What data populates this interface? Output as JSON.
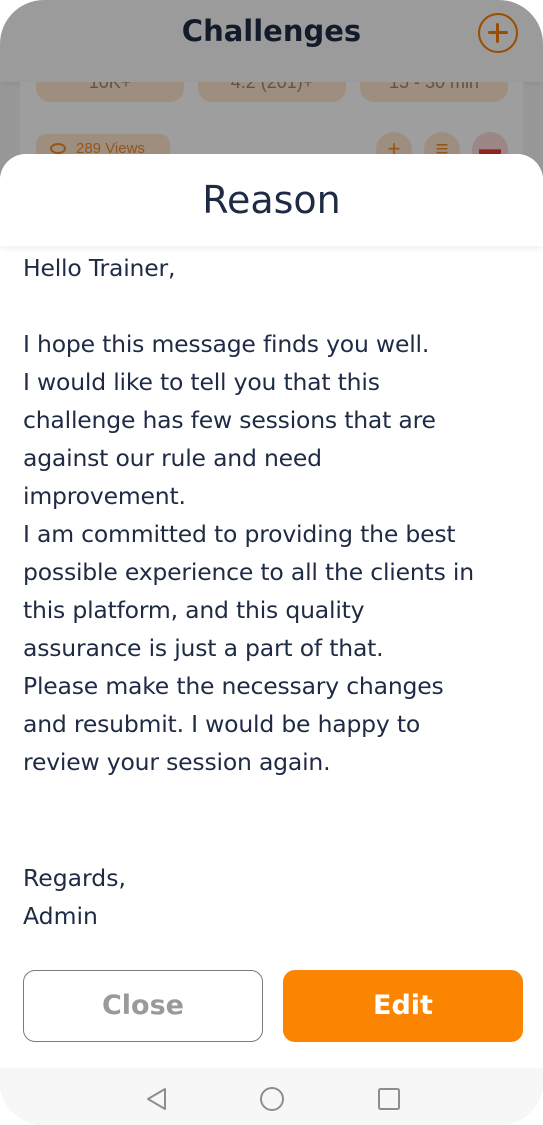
{
  "background_page": {
    "title": "Challenges",
    "add_icon": "plus-circle-icon",
    "stats": [
      "10K+",
      "4.2 (201)+",
      "15 - 30 min"
    ],
    "views": "289 Views",
    "card_actions": [
      "plus-icon",
      "list-edit-icon",
      "trash-icon"
    ],
    "accent_color": "#f57c00",
    "delete_color": "#e53935"
  },
  "sheet": {
    "title": "Reason",
    "greeting": "Hello Trainer,",
    "lines": [
      "I hope this message finds you well.",
      "I would like to tell you that this",
      "challenge has few sessions that are",
      "against our rule and need",
      "improvement.",
      "I am committed to providing the best",
      "possible experience to all the clients in",
      "this platform, and this quality",
      "assurance is just a part of that.",
      "Please make the necessary changes",
      "and resubmit. I would be happy to",
      "review your session again."
    ],
    "regards": "Regards,",
    "signature": "Admin",
    "close_label": "Close",
    "edit_label": "Edit",
    "edit_color": "#fb8500",
    "text_color": "#1f2b44"
  },
  "navbar": {
    "icons": [
      "back-triangle-icon",
      "home-circle-icon",
      "recents-square-icon"
    ]
  }
}
